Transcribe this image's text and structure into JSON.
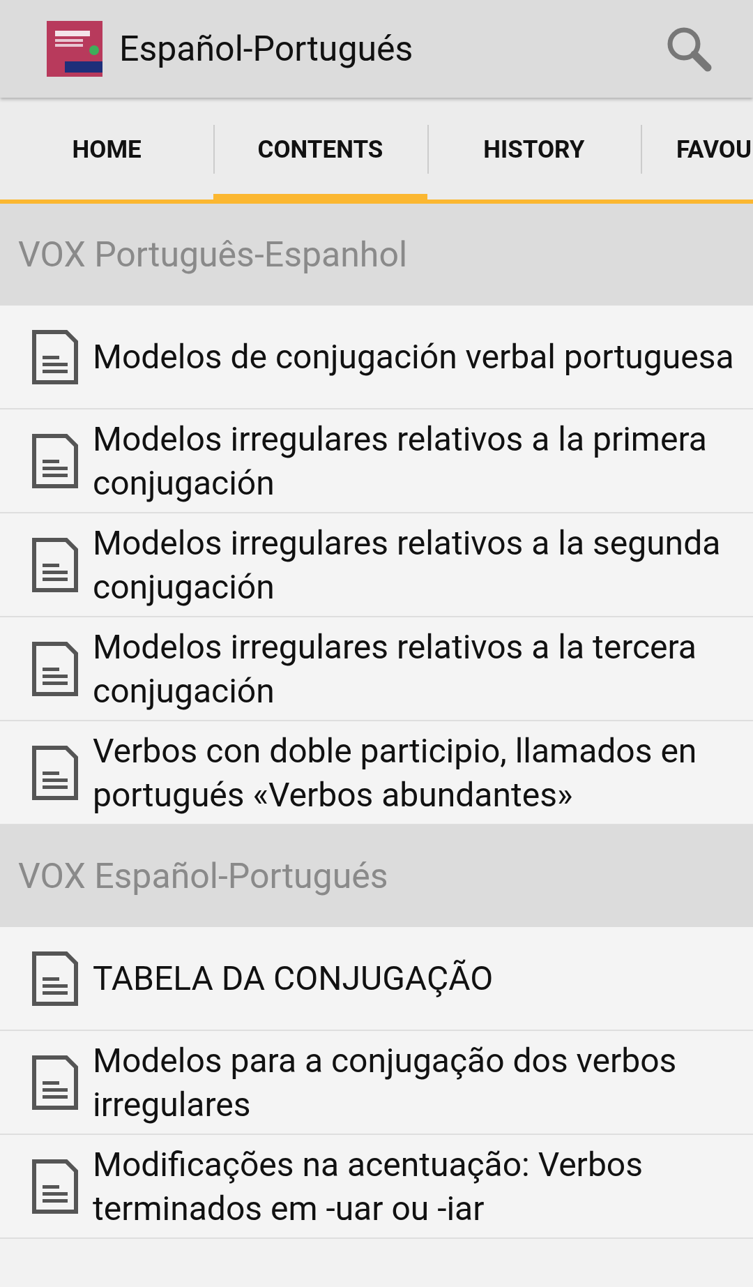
{
  "action_bar": {
    "title": "Español-Portugués"
  },
  "tabs": [
    {
      "label": "HOME",
      "selected": false
    },
    {
      "label": "CONTENTS",
      "selected": true
    },
    {
      "label": "HISTORY",
      "selected": false
    },
    {
      "label": "FAVOU",
      "selected": false
    }
  ],
  "sections": [
    {
      "header": "VOX Português-Espanhol",
      "items": [
        {
          "title": "Modelos de conjugación verbal portuguesa"
        },
        {
          "title": "Modelos irregulares relativos a la primera conjugación"
        },
        {
          "title": "Modelos irregulares relativos a la segunda conjugación"
        },
        {
          "title": "Modelos irregulares relativos a la tercera conjugación"
        },
        {
          "title": "Verbos con doble participio, llamados en portugués «Verbos abundantes»"
        }
      ]
    },
    {
      "header": "VOX Español-Portugués",
      "items": [
        {
          "title": "TABELA DA CONJUGAÇÃO"
        },
        {
          "title": "Modelos para a conjugação dos verbos irregulares"
        },
        {
          "title": "Modificações na acentuação: Verbos terminados em -uar ou -iar"
        }
      ]
    }
  ]
}
